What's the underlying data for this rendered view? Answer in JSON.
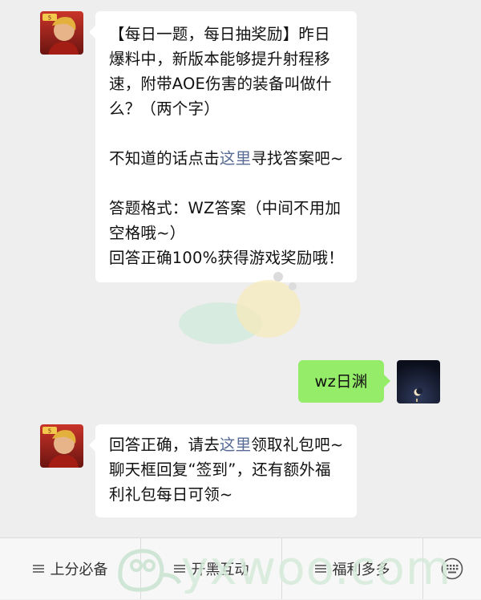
{
  "messages": [
    {
      "from": "official",
      "paragraphs": [
        "【每日一题，每日抽奖励】昨日爆料中，新版本能够提升射程移速，附带AOE伤害的装备叫做什么？（两个字）",
        "",
        "不知道的话点击",
        "",
        "答题格式：WZ答案（中间不用加空格哦~）回答正确100%获得游戏奖励哦！"
      ],
      "question": "【每日一题，每日抽奖励】昨日爆料中，新版本能够提升射程移速，附带AOE伤害的装备叫做什么？（两个字）",
      "hint_prefix": "不知道的话点击",
      "hint_link": "这里",
      "hint_suffix": "寻找答案吧~",
      "format_line": "答题格式：WZ答案（中间不用加空格哦~）",
      "reward_line": "回答正确100%获得游戏奖励哦！"
    },
    {
      "from": "user",
      "text": "wz日渊"
    },
    {
      "from": "official",
      "reply_prefix": "回答正确，请去",
      "reply_link": "这里",
      "reply_suffix": "领取礼包吧~聊天框回复“签到”，还有额外福利礼包每日可领~"
    }
  ],
  "menu": {
    "items": [
      "上分必备",
      "开黑互动",
      "福利多多"
    ],
    "keyboard_icon": "keyboard-icon"
  },
  "watermark": {
    "text": "yxwoo.com"
  },
  "colors": {
    "background": "#eeeeee",
    "user_bubble": "#95ec69",
    "link": "#576b95"
  }
}
